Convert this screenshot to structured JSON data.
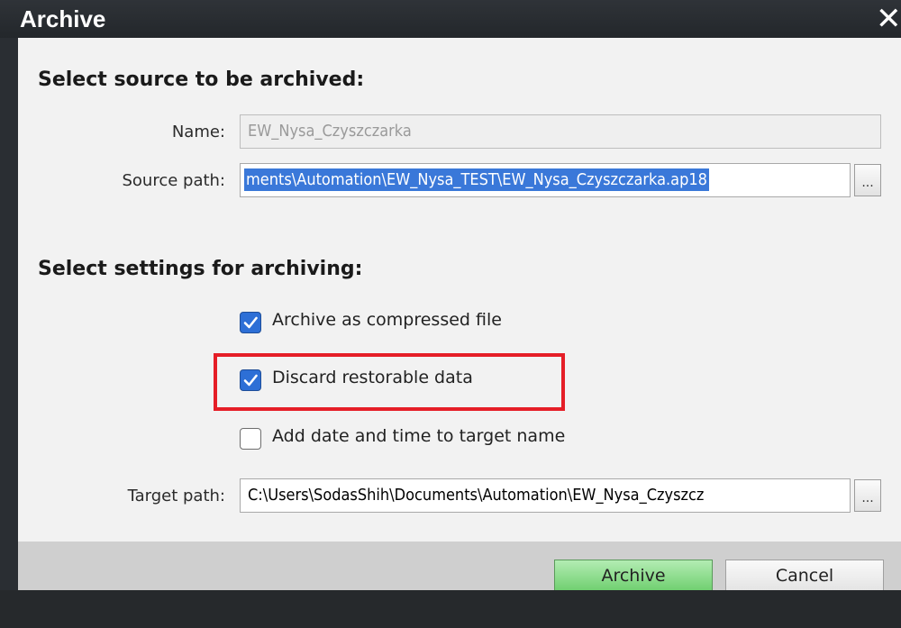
{
  "window": {
    "title": "Archive",
    "close_symbol": "✕"
  },
  "source_section": {
    "heading": "Select source to be archived:",
    "name_label": "Name:",
    "name_value": "EW_Nysa_Czyszczarka",
    "source_path_label": "Source path:",
    "source_path_value": "ments\\Automation\\EW_Nysa_TEST\\EW_Nysa_Czyszczarka.ap18",
    "browse_label": "..."
  },
  "settings_section": {
    "heading": "Select settings for archiving:",
    "options": [
      {
        "label": "Archive as compressed file",
        "checked": true
      },
      {
        "label": "Discard restorable data",
        "checked": true
      },
      {
        "label": "Add date and time to target name",
        "checked": false
      }
    ],
    "target_path_label": "Target path:",
    "target_path_value": "C:\\Users\\SodasShih\\Documents\\Automation\\EW_Nysa_Czyszcz",
    "browse_label": "..."
  },
  "footer": {
    "archive_label": "Archive",
    "cancel_label": "Cancel"
  },
  "colors": {
    "highlight": "#e51e27",
    "accent": "#2d6fd6",
    "archive_button": "#6fcf6f"
  }
}
